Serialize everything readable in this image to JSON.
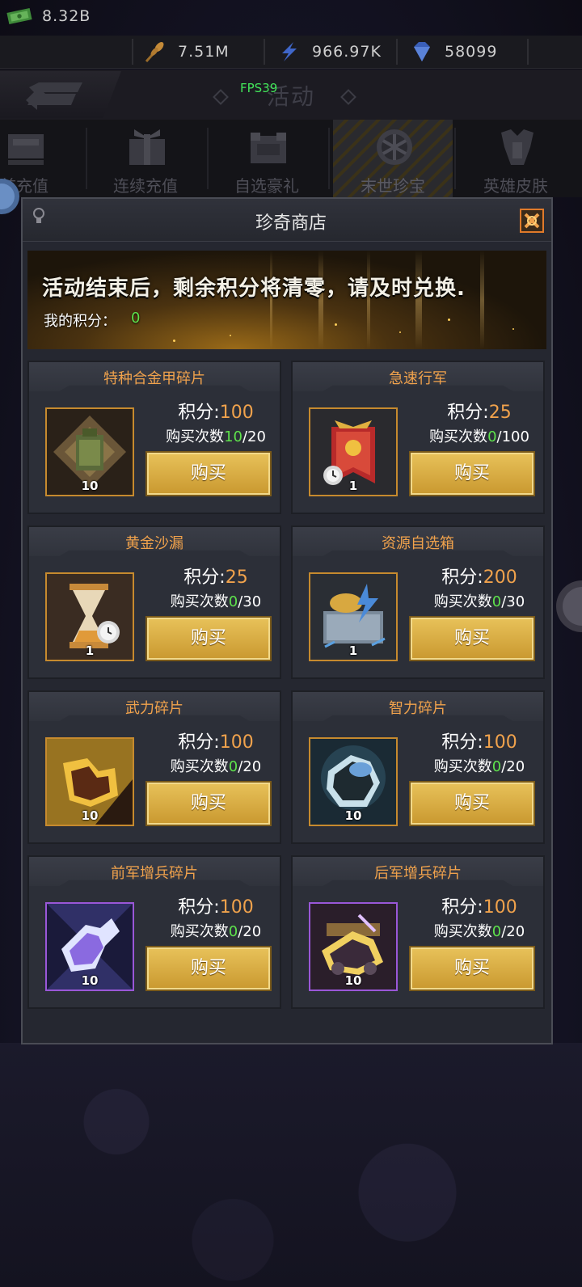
{
  "resources": [
    {
      "icon": "cash-icon",
      "value": "8.32B"
    },
    {
      "icon": "wheat-icon",
      "value": "7.51M"
    },
    {
      "icon": "lightning-icon",
      "value": "966.97K"
    },
    {
      "icon": "diamond-icon",
      "value": "58099"
    }
  ],
  "header": {
    "title": "活动",
    "fps": "FPS39"
  },
  "tabs": [
    {
      "label": "首充值",
      "icon": "chest-icon"
    },
    {
      "label": "连续充值",
      "icon": "gift-icon"
    },
    {
      "label": "自选豪礼",
      "icon": "box-icon"
    },
    {
      "label": "末世珍宝",
      "icon": "wheel-icon"
    },
    {
      "label": "英雄皮肤",
      "icon": "armor-icon"
    }
  ],
  "shop": {
    "title": "珍奇商店",
    "notice": "活动结束后，剩余积分将清零，请及时兑换.",
    "points_label": "我的积分：",
    "points_value": "0"
  },
  "items": [
    {
      "name": "特种合金甲碎片",
      "score_label": "积分:",
      "score": "100",
      "limit_label": "购买次数",
      "bought": "10",
      "limit": "/20",
      "qty": "10",
      "buy": "购买",
      "icon": "alloy-armor-fragment-icon",
      "rarity": "gold"
    },
    {
      "name": "急速行军",
      "score_label": "积分:",
      "score": "25",
      "limit_label": "购买次数",
      "bought": "0",
      "limit": "/100",
      "qty": "1",
      "buy": "购买",
      "icon": "march-banner-icon",
      "rarity": "gold"
    },
    {
      "name": "黄金沙漏",
      "score_label": "积分:",
      "score": "25",
      "limit_label": "购买次数",
      "bought": "0",
      "limit": "/30",
      "qty": "1",
      "buy": "购买",
      "icon": "hourglass-icon",
      "rarity": "gold"
    },
    {
      "name": "资源自选箱",
      "score_label": "积分:",
      "score": "200",
      "limit_label": "购买次数",
      "bought": "0",
      "limit": "/30",
      "qty": "1",
      "buy": "购买",
      "icon": "resource-crate-icon",
      "rarity": "gold"
    },
    {
      "name": "武力碎片",
      "score_label": "积分:",
      "score": "100",
      "limit_label": "购买次数",
      "bought": "0",
      "limit": "/20",
      "qty": "10",
      "buy": "购买",
      "icon": "force-fragment-icon",
      "rarity": "gold"
    },
    {
      "name": "智力碎片",
      "score_label": "积分:",
      "score": "100",
      "limit_label": "购买次数",
      "bought": "0",
      "limit": "/20",
      "qty": "10",
      "buy": "购买",
      "icon": "intellect-fragment-icon",
      "rarity": "gold"
    },
    {
      "name": "前军增兵碎片",
      "score_label": "积分:",
      "score": "100",
      "limit_label": "购买次数",
      "bought": "0",
      "limit": "/20",
      "qty": "10",
      "buy": "购买",
      "icon": "front-troop-fragment-icon",
      "rarity": "purple"
    },
    {
      "name": "后军增兵碎片",
      "score_label": "积分:",
      "score": "100",
      "limit_label": "购买次数",
      "bought": "0",
      "limit": "/20",
      "qty": "10",
      "buy": "购买",
      "icon": "rear-troop-fragment-icon",
      "rarity": "purple"
    }
  ],
  "colors": {
    "accent": "#f0a24c",
    "green": "#5ee24c",
    "button": "#d9ab43",
    "purple_frame": "#9a57d8",
    "gold_frame": "#c68a2e"
  }
}
